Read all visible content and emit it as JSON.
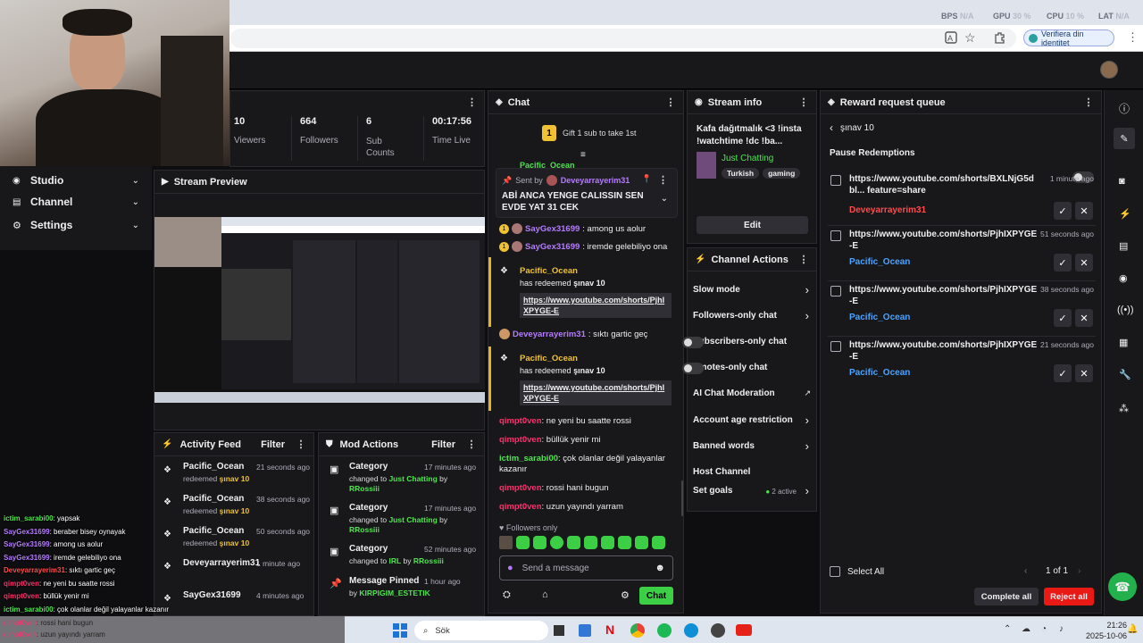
{
  "browser": {
    "stats": {
      "bps_label": "BPS",
      "bps_val": "N/A",
      "gpu_label": "GPU",
      "gpu_val": "30 %",
      "cpu_label": "CPU",
      "cpu_val": "10 %",
      "lat_label": "LAT",
      "lat_val": "N/A"
    },
    "identity_label": "Verifiera din identitet"
  },
  "sidebar": {
    "items": [
      {
        "label": "Studio"
      },
      {
        "label": "Channel"
      },
      {
        "label": "Settings"
      }
    ]
  },
  "stats": [
    {
      "value": "10",
      "label": "Viewers"
    },
    {
      "value": "664",
      "label": "Followers"
    },
    {
      "value": "6",
      "label": "Sub Counts"
    },
    {
      "value": "00:17:56",
      "label": "Time Live"
    }
  ],
  "stream_preview": {
    "title": "Stream Preview"
  },
  "chat": {
    "title": "Chat",
    "gift_text": "Gift 1 sub to take 1st",
    "gift_count": "1",
    "pinned": {
      "sent_by": "Sent by",
      "user": "Deveyarrayerim31",
      "message": "ABİ ANCA YENGE CALISSIN SEN EVDE YAT 31 CEK"
    },
    "partial_user": "Pacific_Ocean",
    "messages": [
      {
        "user": "SayGex31699",
        "text": ": among us aolur"
      },
      {
        "user": "SayGex31699",
        "text": ": iremde gelebiliyo ona"
      }
    ],
    "redeem1": {
      "user": "Pacific_Ocean",
      "has": "has redeemed",
      "reward": "şınav 10",
      "link": "https://www.youtube.com/shorts/PjhIXPYGE-E"
    },
    "dev_msg": {
      "user": "Deveyarrayerim31",
      "text": ": sıktı gartic geç"
    },
    "redeem2": {
      "user": "Pacific_Ocean",
      "has": "has redeemed",
      "reward": "şınav 10",
      "link": "https://www.youtube.com/shorts/PjhIXPYGE-E"
    },
    "lines": [
      {
        "user": "qimpt0ven",
        "text": ": ne yeni bu saatte rossi",
        "color": "#ff2f6d"
      },
      {
        "user": "qimpt0ven",
        "text": ": büllük yenir mi",
        "color": "#ff2f6d"
      },
      {
        "user": "ictim_sarabi00",
        "text": ": çok olanlar değil yalayanlar kazanır",
        "color": "#4fe34f"
      },
      {
        "user": "qimpt0ven",
        "text": ": rossi hani bugun",
        "color": "#ff2f6d"
      },
      {
        "user": "qimpt0ven",
        "text": ": uzun yayındı yarram",
        "color": "#ff2f6d"
      }
    ],
    "followers_only": "Followers only",
    "placeholder": "Send a message",
    "chat_button": "Chat"
  },
  "stream_info": {
    "title": "Stream info",
    "stream_title": "Kafa dağıtmalık <3 !insta !watchtime !dc !ba...",
    "category": "Just Chatting",
    "tags": [
      "Turkish",
      "gaming"
    ],
    "edit_label": "Edit"
  },
  "channel_actions": {
    "title": "Channel Actions",
    "items": [
      {
        "label": "Slow mode",
        "kind": "arrow"
      },
      {
        "label": "Followers-only chat",
        "kind": "arrow"
      },
      {
        "label": "Subscribers-only chat",
        "kind": "toggle"
      },
      {
        "label": "Emotes-only chat",
        "kind": "toggle"
      },
      {
        "label": "AI Chat Moderation",
        "kind": "ext"
      },
      {
        "label": "Account age restriction",
        "kind": "arrow"
      },
      {
        "label": "Banned words",
        "kind": "arrow"
      },
      {
        "label": "Host Channel",
        "kind": "none"
      },
      {
        "label": "Set goals",
        "kind": "goals",
        "extra": "2 active"
      }
    ]
  },
  "reward_queue": {
    "title": "Reward request queue",
    "back_label": "şınav 10",
    "pause_label": "Pause Redemptions",
    "items": [
      {
        "text": "https://www.youtube.com/shorts/BXLNjG5dbl... feature=share",
        "time": "1 minute ago",
        "user": "Deveyarrayerim31",
        "color": "#ff4b4b"
      },
      {
        "text": "https://www.youtube.com/shorts/PjhIXPYGE-E",
        "time": "51 seconds ago",
        "user": "Pacific_Ocean",
        "color": "#49a3ff"
      },
      {
        "text": "https://www.youtube.com/shorts/PjhIXPYGE-E",
        "time": "38 seconds ago",
        "user": "Pacific_Ocean",
        "color": "#49a3ff"
      },
      {
        "text": "https://www.youtube.com/shorts/PjhIXPYGE-E",
        "time": "21 seconds ago",
        "user": "Pacific_Ocean",
        "color": "#49a3ff"
      }
    ],
    "select_all": "Select All",
    "pagination": "1 of 1",
    "complete_all": "Complete all",
    "reject_all": "Reject all"
  },
  "activity_feed": {
    "title": "Activity Feed",
    "filter_label": "Filter",
    "items": [
      {
        "user": "Pacific_Ocean",
        "time": "21 seconds ago",
        "action": "redeemed",
        "reward": "şınav 10"
      },
      {
        "user": "Pacific_Ocean",
        "time": "38 seconds ago",
        "action": "redeemed",
        "reward": "şınav 10"
      },
      {
        "user": "Pacific_Ocean",
        "time": "50 seconds ago",
        "action": "redeemed",
        "reward": "şınav 10"
      },
      {
        "user": "Deveyarrayerim31",
        "time": "1 minute ago",
        "action": "",
        "reward": ""
      },
      {
        "user": "SayGex31699",
        "time": "4 minutes ago",
        "action": "",
        "reward": ""
      }
    ]
  },
  "mod_actions": {
    "title": "Mod Actions",
    "filter_label": "Filter",
    "items": [
      {
        "title": "Category",
        "time": "17 minutes ago",
        "pre": "changed to",
        "value": "Just Chatting",
        "by": "by",
        "user": "RRossiii"
      },
      {
        "title": "Category",
        "time": "17 minutes ago",
        "pre": "changed to",
        "value": "Just Chatting",
        "by": "by",
        "user": "RRossiii"
      },
      {
        "title": "Category",
        "time": "52 minutes ago",
        "pre": "changed to",
        "value": "IRL",
        "by": "by",
        "user": "RRossiii"
      },
      {
        "title": "Message Pinned",
        "time": "1 hour ago",
        "pre": "",
        "value": "",
        "by": "by",
        "user": "KIRPIGIM_ESTETIK"
      }
    ]
  },
  "overlay_chat": [
    {
      "user": "ictim_sarabi00",
      "text": ": yapsak",
      "color": "#4fe34f"
    },
    {
      "user": "SayGex31699",
      "text": ": beraber bisey oynayak",
      "color": "#b57bff"
    },
    {
      "user": "SayGex31699",
      "text": ": among us aolur",
      "color": "#b57bff"
    },
    {
      "user": "SayGex31699",
      "text": ": iremde gelebiliyo ona",
      "color": "#b57bff"
    },
    {
      "user": "Deveyarrayerim31",
      "text": ": sıktı gartic geç",
      "color": "#ff4b4b"
    },
    {
      "user": "qimpt0ven",
      "text": ": ne yeni bu saatte rossi",
      "color": "#ff2f6d"
    },
    {
      "user": "qimpt0ven",
      "text": ": büllük yenir mi",
      "color": "#ff2f6d"
    },
    {
      "user": "ictim_sarabi00",
      "text": ": çok olanlar değil yalayanlar kazanır",
      "color": "#4fe34f"
    },
    {
      "user": "qimpt0ven",
      "text": ": rossi hani bugun",
      "color": "#ff2f6d"
    },
    {
      "user": "qimpt0ven",
      "text": ": uzun yayındı yarram",
      "color": "#ff2f6d"
    }
  ],
  "taskbar": {
    "search_label": "Sök",
    "time": "21:26",
    "date": "2025-10-06"
  }
}
